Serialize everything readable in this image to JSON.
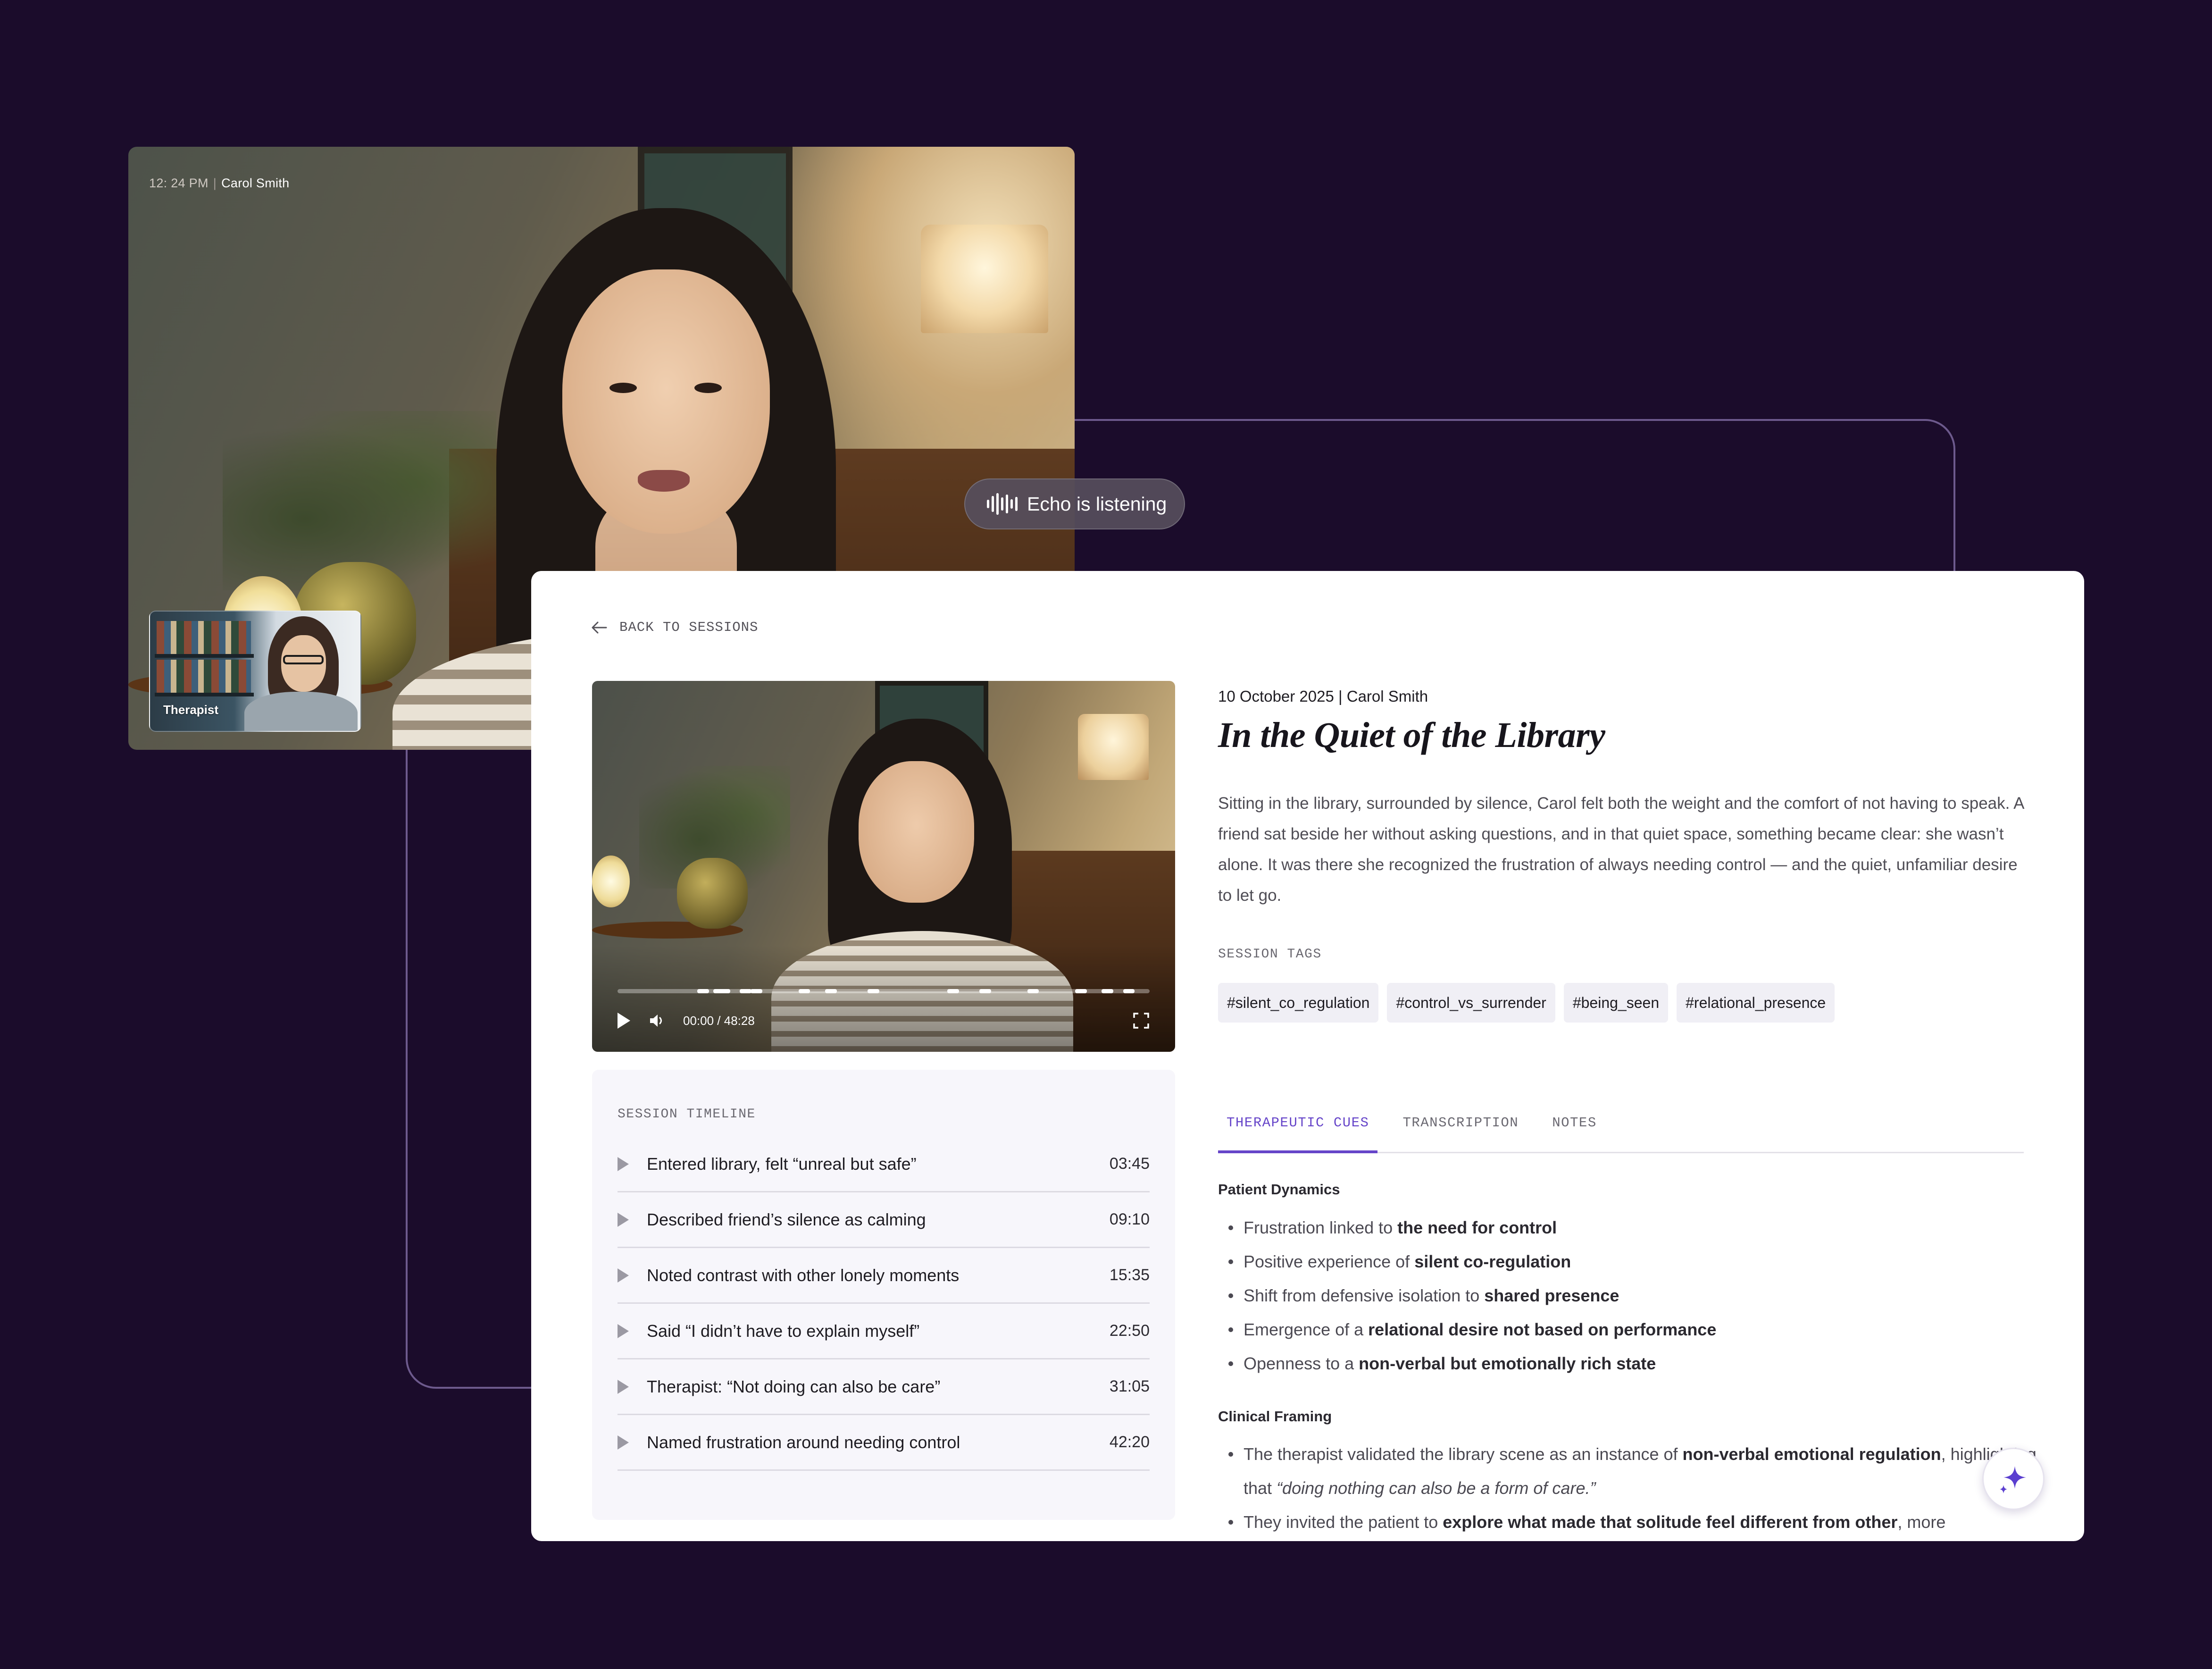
{
  "call": {
    "time": "12: 24 PM",
    "separator": "|",
    "caller_name": "Carol Smith",
    "therapist_label": "Therapist"
  },
  "echo": {
    "label": "Echo is listening",
    "icon": "waveform-icon"
  },
  "panel": {
    "back_label": "BACK TO SESSIONS",
    "player": {
      "time": "00:00 / 48:28",
      "progress_fraction": 0.0,
      "cue_marks": [
        0.15,
        0.18,
        0.19,
        0.23,
        0.25,
        0.34,
        0.39,
        0.47,
        0.62,
        0.68,
        0.77,
        0.86,
        0.91,
        0.95
      ]
    },
    "timeline": {
      "title": "SESSION TIMELINE",
      "items": [
        {
          "text": "Entered library, felt “unreal but safe”",
          "time": "03:45"
        },
        {
          "text": "Described friend’s silence as calming",
          "time": "09:10"
        },
        {
          "text": "Noted contrast with other lonely moments",
          "time": "15:35"
        },
        {
          "text": "Said “I didn’t have to explain myself”",
          "time": "22:50"
        },
        {
          "text": "Therapist: “Not doing can also be care”",
          "time": "31:05"
        },
        {
          "text": "Named frustration around needing control",
          "time": "42:20"
        }
      ]
    },
    "session": {
      "meta": "10 October 2025 | Carol Smith",
      "title": "In the Quiet of the Library",
      "summary": "Sitting in the library, surrounded by silence, Carol felt both the weight and the comfort of not having to speak. A friend sat beside her without asking questions, and in that quiet space, something became clear: she wasn’t alone. It was there she recognized the frustration of always needing control — and the quiet, unfamiliar desire to let go.",
      "tags_label": "SESSION TAGS",
      "tags": [
        "#silent_co_regulation",
        "#control_vs_surrender",
        "#being_seen",
        "#relational_presence"
      ]
    },
    "tabs": {
      "active": "THERAPEUTIC CUES",
      "items": [
        "THERAPEUTIC CUES",
        "TRANSCRIPTION",
        "NOTES"
      ]
    },
    "cues": {
      "dynamics_heading": "Patient Dynamics",
      "dynamics": [
        {
          "pre": "Frustration linked to ",
          "bold": "the need for control",
          "post": ""
        },
        {
          "pre": "Positive experience of ",
          "bold": "silent co-regulation",
          "post": ""
        },
        {
          "pre": "Shift from defensive isolation to ",
          "bold": "shared presence",
          "post": ""
        },
        {
          "pre": "Emergence of a ",
          "bold": "relational desire not based on performance",
          "post": ""
        },
        {
          "pre": "Openness to a ",
          "bold": "non-verbal but emotionally rich state",
          "post": ""
        }
      ],
      "framing_heading": "Clinical Framing",
      "framing": [
        {
          "pre": "The therapist validated the library scene as an instance of ",
          "bold": "non-verbal emotional regulation",
          "post": ", highlighting that ",
          "italic": "“doing nothing can also be a form of care.”"
        },
        {
          "pre": "They invited the patient to ",
          "bold": "explore what made that solitude feel different from other",
          "post": ", more",
          "italic": ""
        }
      ]
    },
    "fab_icon": "sparkle-icon"
  },
  "colors": {
    "background": "#1b0c2b",
    "accent": "#6645c9",
    "frame_outline": "#6d5a8d"
  }
}
